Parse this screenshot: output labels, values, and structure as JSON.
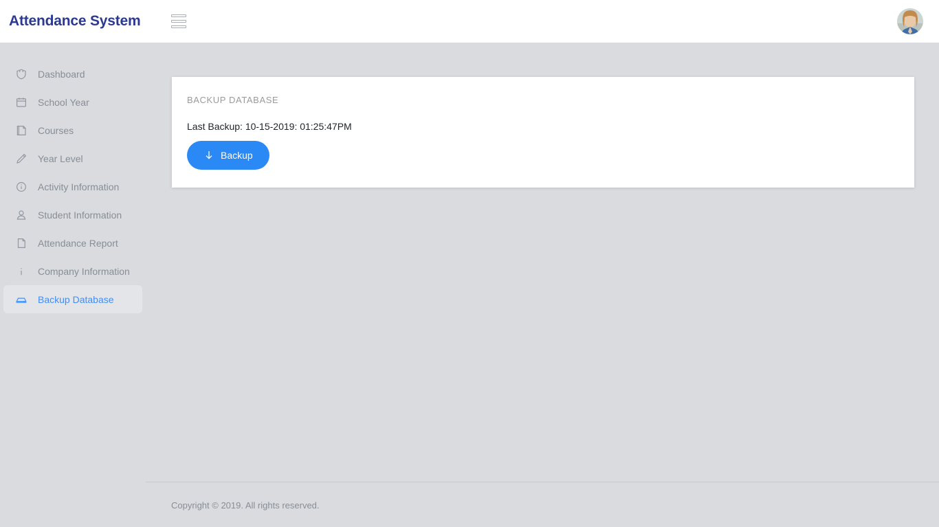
{
  "header": {
    "brand": "Attendance System",
    "menu_icon": "hamburger-icon",
    "avatar_icon": "user-avatar"
  },
  "sidebar": {
    "items": [
      {
        "label": "Dashboard",
        "icon": "shield-icon",
        "active": false
      },
      {
        "label": "School Year",
        "icon": "calendar-icon",
        "active": false
      },
      {
        "label": "Courses",
        "icon": "book-icon",
        "active": false
      },
      {
        "label": "Year Level",
        "icon": "pencil-icon",
        "active": false
      },
      {
        "label": "Activity Information",
        "icon": "info-circle-icon",
        "active": false
      },
      {
        "label": "Student Information",
        "icon": "user-icon",
        "active": false
      },
      {
        "label": "Attendance Report",
        "icon": "file-icon",
        "active": false
      },
      {
        "label": "Company Information",
        "icon": "information-icon",
        "active": false
      },
      {
        "label": "Backup Database",
        "icon": "database-icon",
        "active": true
      }
    ]
  },
  "main": {
    "card": {
      "title": "BACKUP DATABASE",
      "last_backup": "Last Backup: 10-15-2019: 01:25:47PM",
      "button_label": "Backup",
      "button_icon": "download-arrow-icon"
    }
  },
  "footer": {
    "copyright": "Copyright © 2019. All rights reserved."
  },
  "colors": {
    "brand": "#2b3a8f",
    "accent": "#2a89f5",
    "active_text": "#3f8ef7",
    "page_bg": "#dadbdf",
    "card_bg": "#ffffff",
    "muted_text": "#868e96"
  }
}
